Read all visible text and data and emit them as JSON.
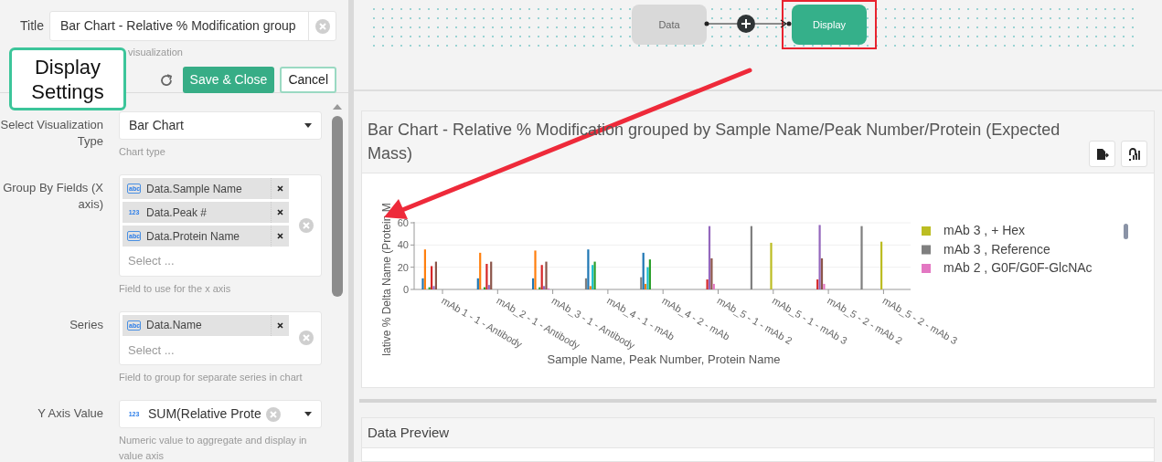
{
  "callout": {
    "text": "Display Settings"
  },
  "settings_panel": {
    "title_field": {
      "label": "Title",
      "value": "Bar Chart - Relative % Modification group",
      "helper": "visualization"
    },
    "buttons": [
      {
        "label": "Save & Close",
        "kind": "primary"
      },
      {
        "label": "Cancel",
        "kind": "secondary"
      }
    ],
    "fields": [
      {
        "kind": "select",
        "label": "Select Visualization Type",
        "value": "Bar Chart",
        "helper": "Chart type"
      },
      {
        "kind": "multi",
        "label": "Group By Fields (X axis)",
        "chips": [
          {
            "badge": "abc",
            "text": "Data.Sample Name"
          },
          {
            "badge": "123",
            "text": "Data.Peak #"
          },
          {
            "badge": "abc",
            "text": "Data.Protein Name"
          }
        ],
        "placeholder": "Select ...",
        "helper": "Field to use for the x axis"
      },
      {
        "kind": "multi",
        "label": "Series",
        "chips": [
          {
            "badge": "abc",
            "text": "Data.Name"
          }
        ],
        "placeholder": "Select ...",
        "helper": "Field to group for separate series in chart"
      },
      {
        "kind": "value_select",
        "label": "Y Axis Value",
        "badge": "123",
        "value": "SUM(Relative Prote",
        "helper": "Numeric value to aggregate and display in value axis"
      }
    ]
  },
  "flow": {
    "nodes": [
      {
        "label": "Data",
        "kind": "source",
        "highlighted": false
      },
      {
        "label": "Display",
        "kind": "display",
        "highlighted": true
      }
    ]
  },
  "chart_card": {
    "title": "Bar Chart - Relative % Modification grouped by Sample Name/Peak Number/Protein (Expected Mass)",
    "chart_data": {
      "type": "bar",
      "xlabel": "Sample Name, Peak Number, Protein Name",
      "ylabel": "lative % Delta Name (Protein M",
      "categories": [
        "mAb 1 - 1 - Antibody",
        "mAb_2 - 1 - Antibody",
        "mAb_3 - 1 - Antibody",
        "mAb_4 - 1 - mAb",
        "mAb_4 - 2 - mAb",
        "mAb_5 - 1 - mAb 2",
        "mAb_5 - 1 - mAb 3",
        "mAb_5 - 2 - mAb 2",
        "mAb_5 - 2 - mAb 3"
      ],
      "ylim": [
        0,
        60
      ],
      "yticks": [
        0,
        20,
        40,
        60
      ],
      "series": [
        {
          "color": "#7f7f7f",
          "values": [
            null,
            null,
            null,
            10,
            11,
            null,
            57,
            null,
            57
          ]
        },
        {
          "color": "#1f77b4",
          "values": [
            10,
            10,
            10,
            36,
            33,
            null,
            null,
            null,
            null
          ]
        },
        {
          "color": "#ff7f0e",
          "values": [
            36,
            33,
            35,
            3,
            5,
            null,
            null,
            null,
            null
          ]
        },
        {
          "color": "#17becf",
          "values": [
            null,
            null,
            null,
            22,
            20,
            null,
            null,
            null,
            null
          ]
        },
        {
          "color": "#2ca02c",
          "values": [
            2,
            2,
            2,
            25,
            27,
            null,
            null,
            null,
            null
          ]
        },
        {
          "color": "#d62728",
          "values": [
            21,
            23,
            22,
            null,
            null,
            9,
            null,
            9,
            null
          ]
        },
        {
          "color": "#9467bd",
          "values": [
            3,
            4,
            3,
            null,
            null,
            57,
            null,
            58,
            null
          ]
        },
        {
          "color": "#8c564b",
          "values": [
            25,
            25,
            25,
            null,
            null,
            28,
            null,
            28,
            null
          ]
        },
        {
          "color": "#e377c2",
          "values": [
            null,
            null,
            1,
            null,
            null,
            5,
            null,
            5,
            null
          ]
        },
        {
          "color": "#bcbd22",
          "values": [
            null,
            null,
            null,
            null,
            null,
            null,
            42,
            null,
            43
          ]
        }
      ]
    },
    "legend": [
      {
        "label": "mAb 3 , + Hex",
        "color": "#bcbd22"
      },
      {
        "label": "mAb 3 , Reference",
        "color": "#7f7f7f"
      },
      {
        "label": "mAb 2 , G0F/G0F-GlcNAc",
        "color": "#e377c2"
      }
    ]
  },
  "data_preview": {
    "title": "Data Preview"
  }
}
